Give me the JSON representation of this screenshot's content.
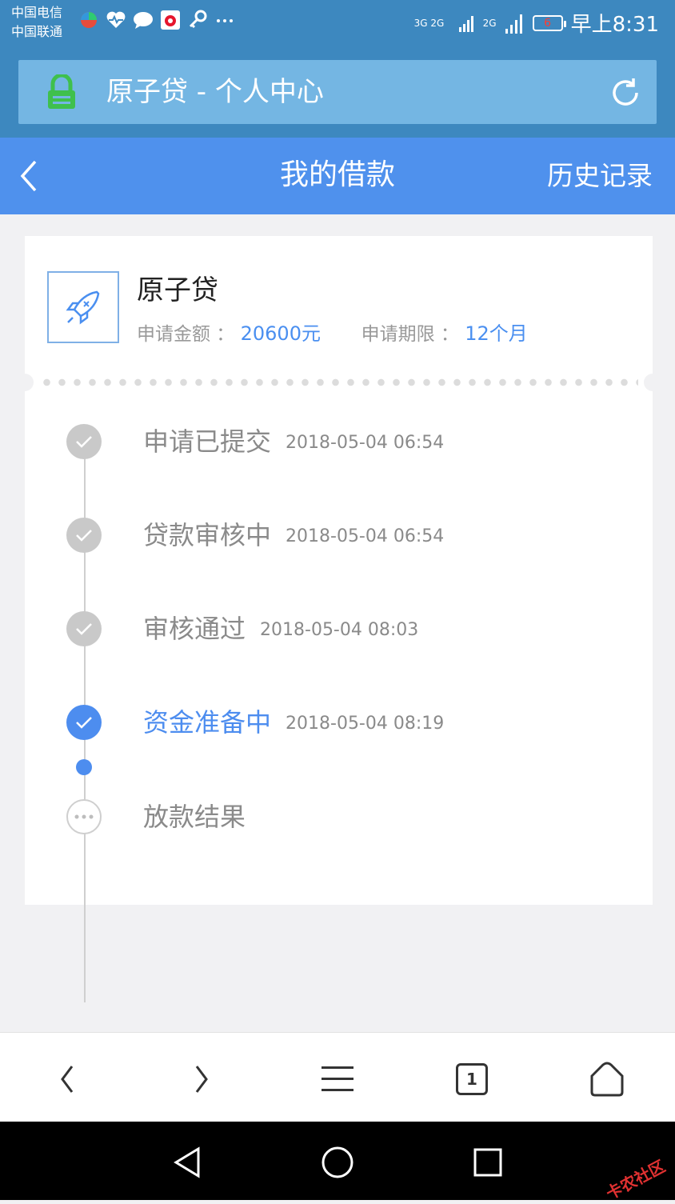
{
  "status_bar": {
    "carrier_1": "中国电信",
    "carrier_2": "中国联通",
    "signal_1": "3G 2G",
    "signal_2": "2G",
    "battery": "6",
    "time": "早上8:31"
  },
  "browser": {
    "page_title": "原子贷 - 个人中心",
    "tab_count": "1"
  },
  "header": {
    "title": "我的借款",
    "history_label": "历史记录"
  },
  "loan": {
    "product_name": "原子贷",
    "amount_label": "申请金额 ：",
    "amount_value": "20600元",
    "term_label": "申请期限 ：",
    "term_value": "12个月"
  },
  "timeline": [
    {
      "label": "申请已提交",
      "time": "2018-05-04 06:54",
      "state": "done"
    },
    {
      "label": "贷款审核中",
      "time": "2018-05-04 06:54",
      "state": "done"
    },
    {
      "label": "审核通过",
      "time": "2018-05-04 08:03",
      "state": "done"
    },
    {
      "label": "资金准备中",
      "time": "2018-05-04 08:19",
      "state": "active"
    },
    {
      "label": "放款结果",
      "time": "",
      "state": "pending"
    }
  ],
  "watermark": "卡农社区",
  "colors": {
    "accent": "#4d8def",
    "header": "#4f91ed",
    "browser_bar": "#3d88bf",
    "lock": "#3fc04d"
  }
}
